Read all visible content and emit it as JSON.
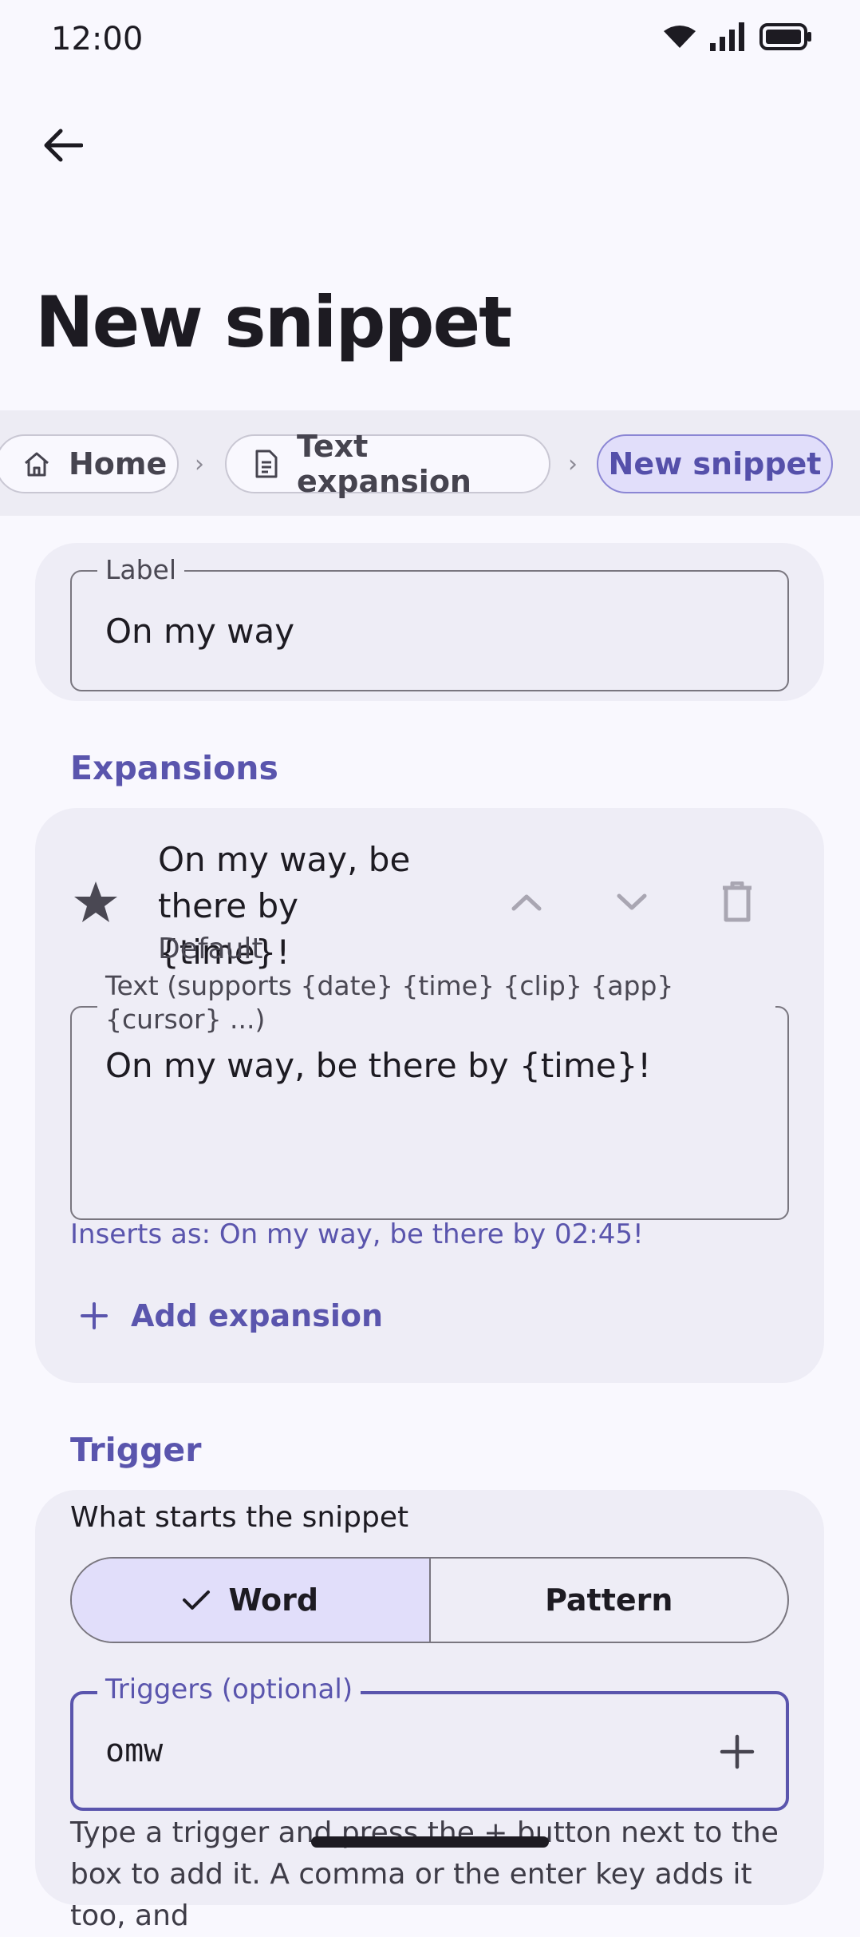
{
  "status": {
    "time": "12:00",
    "icons": [
      "wifi-icon",
      "signal-icon",
      "battery-icon"
    ]
  },
  "header": {
    "title": "New snippet",
    "back_icon": "arrow-left-icon"
  },
  "breadcrumb": [
    {
      "label": "Home",
      "icon": "home-icon"
    },
    {
      "label": "Text expansion",
      "icon": "document-icon"
    },
    {
      "label": "New snippet",
      "active": true
    }
  ],
  "label_field": {
    "legend": "Label",
    "value": "On my way"
  },
  "expansions": {
    "heading": "Expansions",
    "item": {
      "text": "On my way, be there by {time}!",
      "subtitle": "Default",
      "star_icon": "star-icon",
      "actions": [
        "chevron-up-icon",
        "chevron-down-icon",
        "trash-icon"
      ]
    },
    "text_field": {
      "legend": "Text (supports {date} {time} {clip} {app} {cursor} ...)",
      "value": "On my way, be there by {time}!"
    },
    "preview": "Inserts as: On my way, be there by 02:45!",
    "add_label": "Add expansion"
  },
  "trigger": {
    "heading": "Trigger",
    "caption": "What starts the snippet",
    "options": [
      {
        "label": "Word",
        "selected": true
      },
      {
        "label": "Pattern",
        "selected": false
      }
    ],
    "field": {
      "legend": "Triggers (optional)",
      "value": "omw"
    },
    "help": "Type a trigger and press the + button next to the box to add it. A comma or the enter key adds it too, and"
  },
  "colors": {
    "accent": "#5a55ad",
    "selected_fill": "#e1defa",
    "card": "#eeedf6",
    "background": "#f9f8fe"
  }
}
